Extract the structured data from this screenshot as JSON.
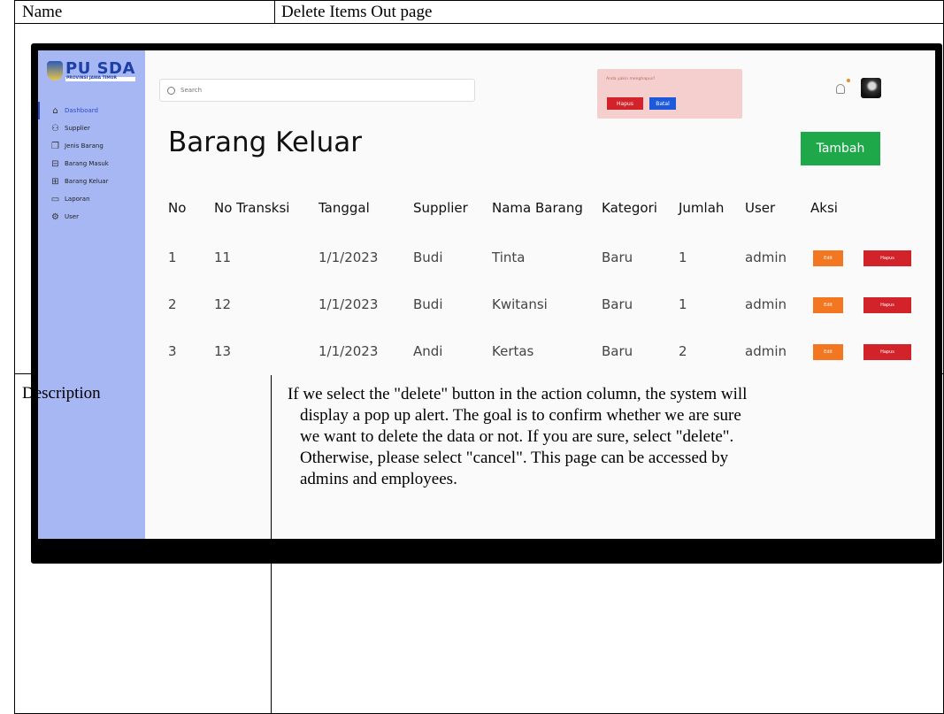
{
  "doc": {
    "name_label": "Name",
    "name_value": "Delete Items Out page",
    "description_label": "Description",
    "description_lines": [
      "If we select the \"delete\" button in the action column, the system will",
      "display a pop up alert. The goal is to confirm whether we are sure",
      "we want to delete the data or not. If you are sure, select \"delete\".",
      "Otherwise, please select \"cancel\". This page can be accessed by",
      "admins and employees."
    ]
  },
  "app": {
    "logo": {
      "title": "PU SDA",
      "subtitle": "PROVINSI JAWA TIMUR"
    },
    "sidebar": {
      "items": [
        {
          "label": "Dashboard",
          "icon": "home-icon",
          "active": true
        },
        {
          "label": "Supplier",
          "icon": "users-icon",
          "active": false
        },
        {
          "label": "Jenis Barang",
          "icon": "layers-icon",
          "active": false
        },
        {
          "label": "Barang Masuk",
          "icon": "inbox-in-icon",
          "active": false
        },
        {
          "label": "Barang Keluar",
          "icon": "inbox-out-icon",
          "active": false
        },
        {
          "label": "Laporan",
          "icon": "report-icon",
          "active": false
        },
        {
          "label": "User",
          "icon": "gear-icon",
          "active": false
        }
      ]
    },
    "search": {
      "placeholder": "Search"
    },
    "alert": {
      "message": "Anda yakin menghapus?",
      "confirm_label": "Hapus",
      "cancel_label": "Batal"
    },
    "page_title": "Barang Keluar",
    "add_button": "Tambah",
    "table": {
      "columns": [
        "No",
        "No Transksi",
        "Tanggal",
        "Supplier",
        "Nama Barang",
        "Kategori",
        "Jumlah",
        "User",
        "Aksi"
      ],
      "rows": [
        [
          "1",
          "11",
          "1/1/2023",
          "Budi",
          "Tinta",
          "Baru",
          "1",
          "admin"
        ],
        [
          "2",
          "12",
          "1/1/2023",
          "Budi",
          "Kwitansi",
          "Baru",
          "1",
          "admin"
        ],
        [
          "3",
          "13",
          "1/1/2023",
          "Andi",
          "Kertas",
          "Baru",
          "2",
          "admin"
        ]
      ],
      "edit_label": "Edit",
      "delete_label": "Hapus"
    },
    "colors": {
      "sidebar": "#a7b7f3",
      "add": "#1fa84a",
      "edit": "#f37621",
      "delete": "#d3232a",
      "cancel": "#1d5adb",
      "alert_bg": "#f4cfcd"
    }
  }
}
